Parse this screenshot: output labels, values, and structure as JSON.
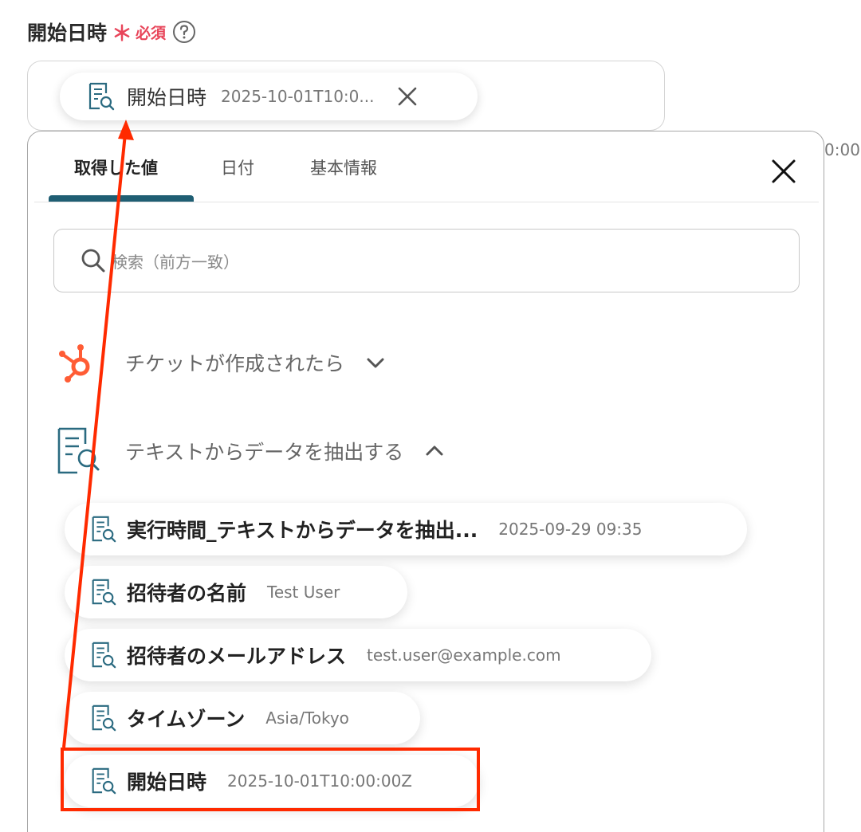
{
  "field": {
    "label": "開始日時",
    "asterisk": "＊",
    "required": "必須",
    "help_icon": "question-circle-icon"
  },
  "selected": {
    "label": "開始日時",
    "value": "2025-10-01T10:0...",
    "icon": "document-search-icon",
    "remove_icon": "close-icon"
  },
  "right_peek": "0:00",
  "popup": {
    "tabs": [
      {
        "label": "取得した値",
        "active": true
      },
      {
        "label": "日付",
        "active": false
      },
      {
        "label": "基本情報",
        "active": false
      }
    ],
    "close_icon": "close-icon",
    "search": {
      "placeholder": "検索（前方一致）",
      "icon": "search-icon"
    },
    "groups": [
      {
        "label": "チケットが作成されたら",
        "icon": "hubspot-logo-icon",
        "expanded": false
      },
      {
        "label": "テキストからデータを抽出する",
        "icon": "document-search-icon",
        "expanded": true
      }
    ],
    "items": [
      {
        "label": "実行時間_テキストからデータを抽出...",
        "value": "2025-09-29 09:35"
      },
      {
        "label": "招待者の名前",
        "value": "Test User"
      },
      {
        "label": "招待者のメールアドレス",
        "value": "test.user@example.com"
      },
      {
        "label": "タイムゾーン",
        "value": "Asia/Tokyo"
      },
      {
        "label": "開始日時",
        "value": "2025-10-01T10:00:00Z"
      }
    ]
  },
  "colors": {
    "accent": "#1f5e73",
    "required": "#e8455a",
    "hubspot": "#ff5c35",
    "annotation": "#ff2a00"
  }
}
